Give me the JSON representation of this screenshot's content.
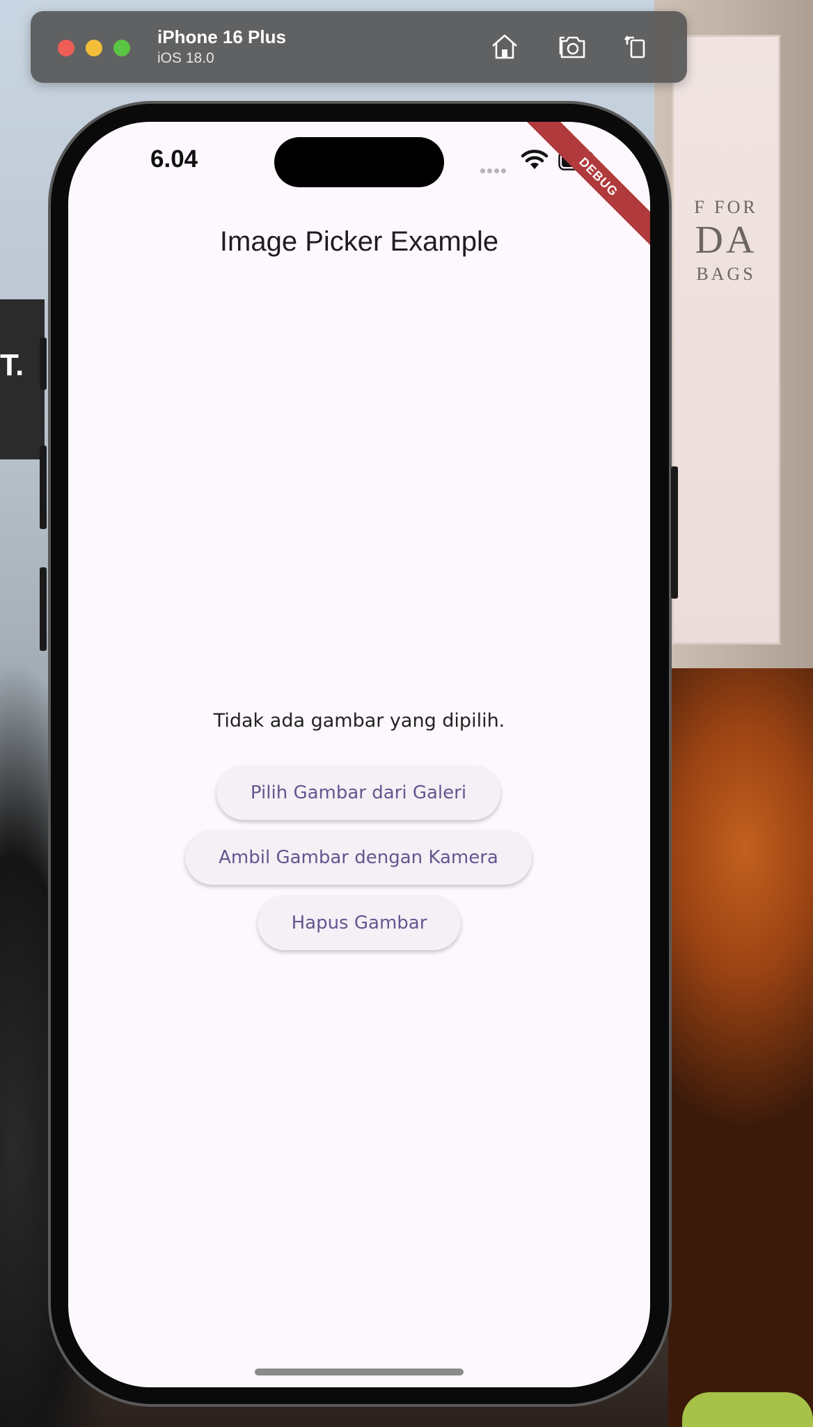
{
  "simulator": {
    "device_name": "iPhone 16 Plus",
    "os_version": "iOS 18.0",
    "toolbar_icons": [
      "home-icon",
      "screenshot-icon",
      "rotate-icon"
    ]
  },
  "status_bar": {
    "time": "6.04",
    "icons": [
      "signal-dots-icon",
      "wifi-icon",
      "battery-icon"
    ]
  },
  "debug_banner": "DEBUG",
  "app": {
    "title": "Image Picker Example",
    "empty_message": "Tidak ada gambar yang dipilih.",
    "buttons": {
      "gallery": "Pilih Gambar dari Galeri",
      "camera": "Ambil Gambar dengan Kamera",
      "remove": "Hapus Gambar"
    }
  },
  "background": {
    "billboard_lines": [
      "F FOR",
      "DA",
      "BAGS"
    ],
    "sign_text": "T."
  },
  "colors": {
    "screen_background": "#fdf7fe",
    "button_text": "#65558f",
    "button_background": "#f4f0f6",
    "debug_banner": "#b13a3c"
  }
}
